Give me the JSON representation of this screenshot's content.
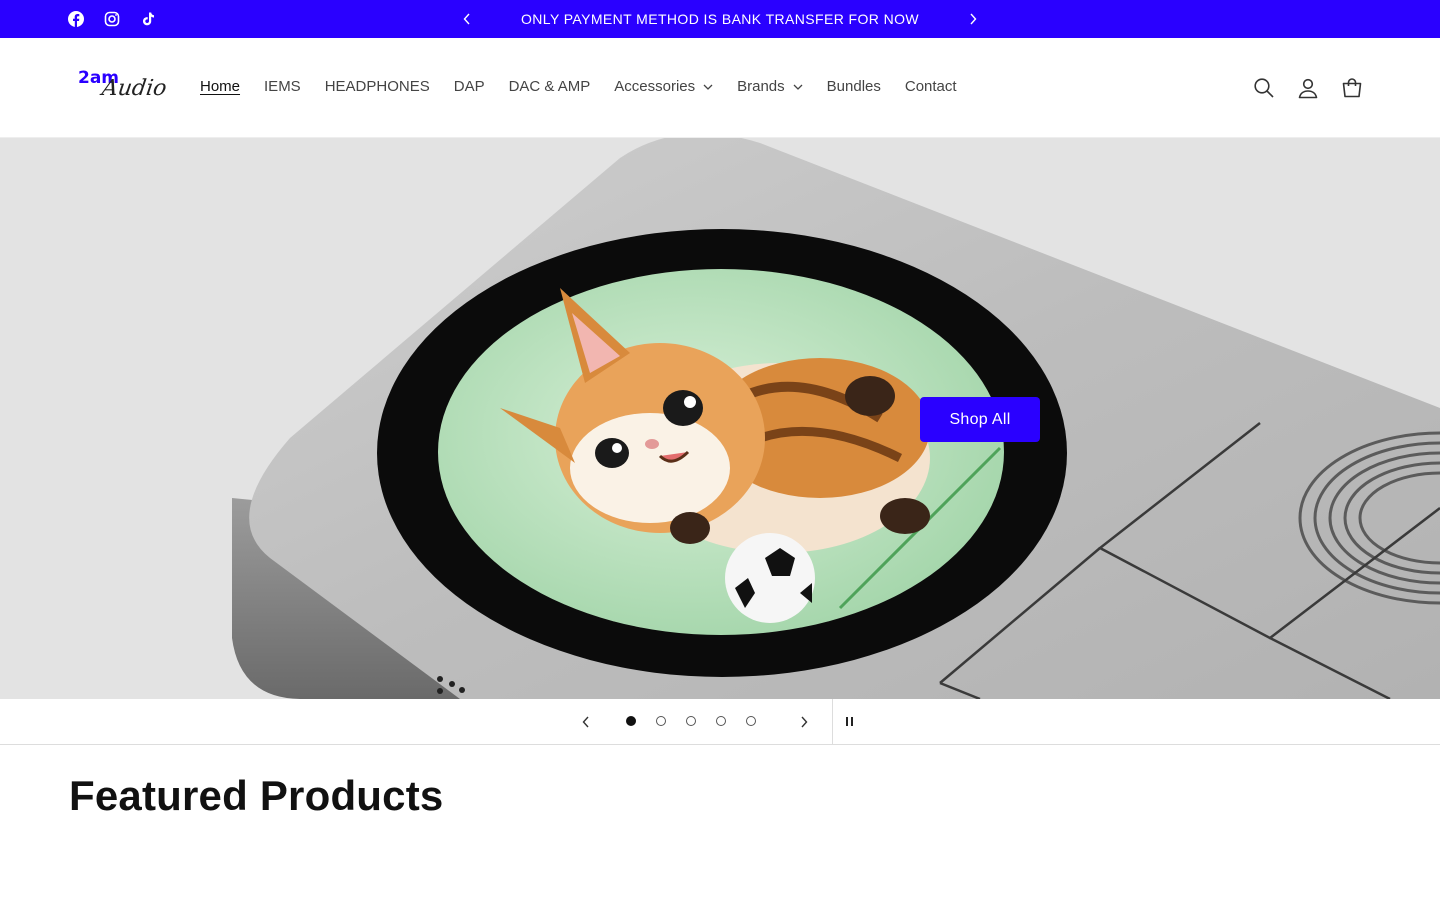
{
  "announcement": {
    "text": "ONLY PAYMENT METHOD IS BANK TRANSFER FOR NOW",
    "background": "#2a00ff"
  },
  "social_icons": [
    "facebook-icon",
    "instagram-icon",
    "tiktok-icon"
  ],
  "logo": {
    "part1": "2am",
    "part2": "Audio"
  },
  "nav": {
    "items": [
      {
        "label": "Home",
        "active": true
      },
      {
        "label": "IEMS"
      },
      {
        "label": "HEADPHONES"
      },
      {
        "label": "DAP"
      },
      {
        "label": "DAC & AMP"
      },
      {
        "label": "Accessories",
        "dropdown": true
      },
      {
        "label": "Brands",
        "dropdown": true
      },
      {
        "label": "Bundles"
      },
      {
        "label": "Contact"
      }
    ]
  },
  "header_icons": [
    "search-icon",
    "account-icon",
    "cart-icon"
  ],
  "hero": {
    "button_label": "Shop All",
    "accent": "#2a00ff",
    "slides_total": 5,
    "active_slide": 1
  },
  "featured": {
    "title": "Featured Products"
  }
}
